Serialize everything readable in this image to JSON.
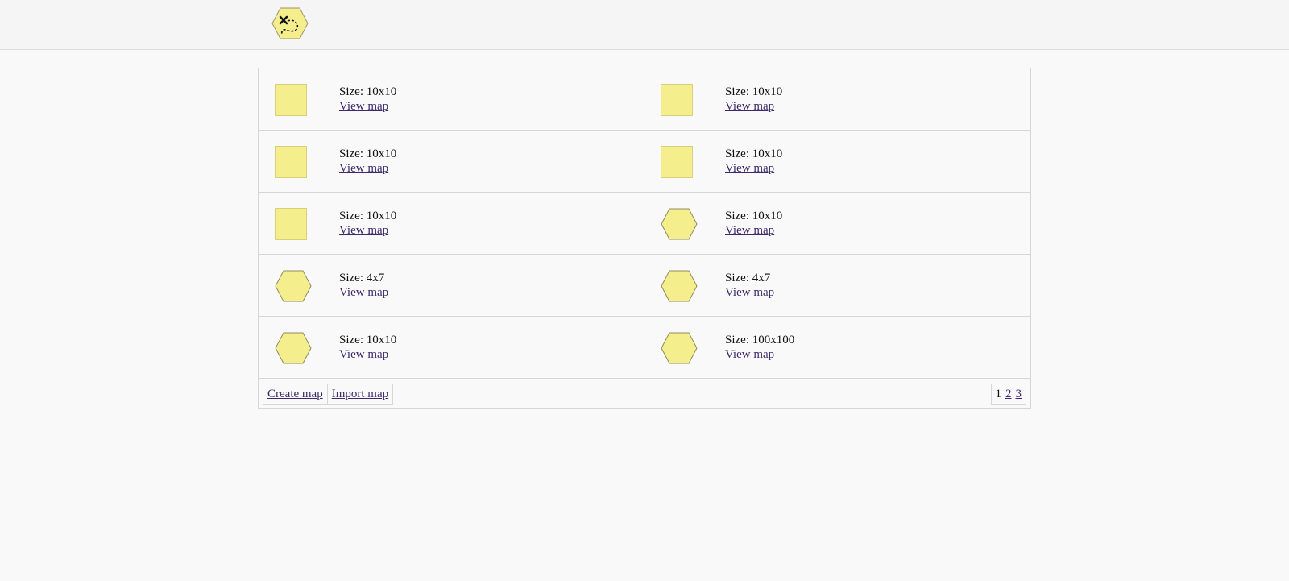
{
  "header": {
    "logo_icon": "treasure-map-hex-icon",
    "accent_color": "#f5ee8c"
  },
  "maps": [
    {
      "shape": "square",
      "size_label": "Size: 10x10",
      "link_label": "View map"
    },
    {
      "shape": "square",
      "size_label": "Size: 10x10",
      "link_label": "View map"
    },
    {
      "shape": "square",
      "size_label": "Size: 10x10",
      "link_label": "View map"
    },
    {
      "shape": "square",
      "size_label": "Size: 10x10",
      "link_label": "View map"
    },
    {
      "shape": "square",
      "size_label": "Size: 10x10",
      "link_label": "View map"
    },
    {
      "shape": "hexagon",
      "size_label": "Size: 10x10",
      "link_label": "View map"
    },
    {
      "shape": "hexagon",
      "size_label": "Size: 4x7",
      "link_label": "View map"
    },
    {
      "shape": "hexagon",
      "size_label": "Size: 4x7",
      "link_label": "View map"
    },
    {
      "shape": "hexagon",
      "size_label": "Size: 10x10",
      "link_label": "View map"
    },
    {
      "shape": "hexagon",
      "size_label": "Size: 100x100",
      "link_label": "View map"
    }
  ],
  "footer": {
    "create_label": "Create map",
    "import_label": "Import map"
  },
  "pagination": {
    "current": "1",
    "pages": [
      "2",
      "3"
    ]
  }
}
